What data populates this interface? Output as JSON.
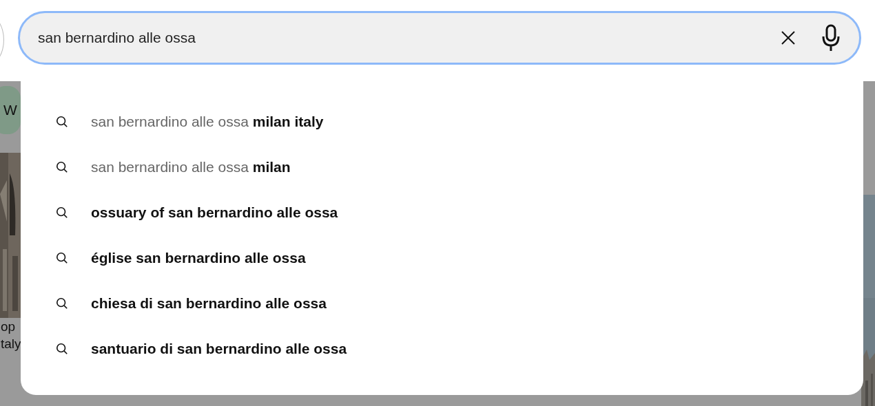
{
  "search": {
    "value": "san bernardino alle ossa"
  },
  "suggestions": [
    {
      "prefix": "san bernardino alle ossa",
      "completion": "milan italy"
    },
    {
      "prefix": "san bernardino alle ossa",
      "completion": "milan"
    },
    {
      "completion": "ossuary of san bernardino alle ossa"
    },
    {
      "completion": "église san bernardino alle ossa"
    },
    {
      "completion": "chiesa di san bernardino alle ossa"
    },
    {
      "completion": "santuario di san bernardino alle ossa"
    }
  ],
  "background": {
    "chip": "W",
    "card_lines": [
      "op",
      "taly"
    ]
  }
}
